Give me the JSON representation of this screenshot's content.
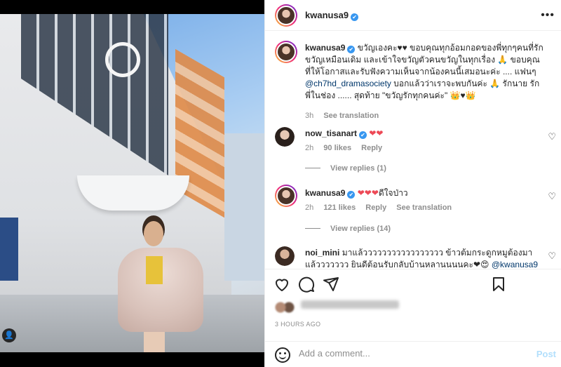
{
  "post": {
    "author": "kwanusa9",
    "verified_mark": "✔",
    "more_options": "•••",
    "avatar_badge": "👤"
  },
  "caption": {
    "username": "kwanusa9",
    "text_part1": "ขวัญเองคะ♥♥ ขอบคุณทุกอ้อมกอดของพี่ทุกๆคนที่รักขวัญเหมือนเดิม และเข้าใจขวัญตัวคนขวัญในทุกเรื่อง 🙏 ขอบคุณที่ให้โอกาสและรับฟังความเห็นจากน้องคนนี้เสมอนะค่ะ .... แฟนๆ",
    "mention": "@ch7hd_dramasociety",
    "text_part2": "บอกแล้วว่าเราจะพบกันค่ะ 🙏 รักนาย รักพี่ในช่อง ...... สุดท้าย \"ขวัญรักทุกคนค่ะ\" 👑♥👑",
    "time": "3h",
    "see_translation": "See translation"
  },
  "comments": [
    {
      "username": "now_tisanart",
      "text": "❤❤",
      "time": "2h",
      "likes": "90 likes",
      "reply": "Reply",
      "view_replies": "View replies (1)"
    },
    {
      "username": "kwanusa9",
      "hearts": "❤❤❤",
      "text": "ดีใจป่าว",
      "time": "2h",
      "likes": "121 likes",
      "reply": "Reply",
      "see_translation": "See translation",
      "view_replies": "View replies (14)"
    },
    {
      "username": "noi_mini",
      "text": "มาแล้ววววววววววววววววว ข้าวต้มกระดูกหมูต้องมาแล้ววววววว ยินดีต้อนรับกลับบ้านหลานนนนคะ❤😍",
      "mention": "@kwanusa9"
    }
  ],
  "likes_line": {
    "prefix": "Liked by",
    "blurred_text": "fan_name and others"
  },
  "timestamp": "3 HOURS AGO",
  "add_comment": {
    "placeholder": "Add a comment...",
    "post_label": "Post"
  },
  "colors": {
    "verified": "#3897f0",
    "heart": "#ed4956",
    "mention": "#00376b",
    "post_button": "#b2dffc",
    "muted": "#8e8e8e"
  }
}
